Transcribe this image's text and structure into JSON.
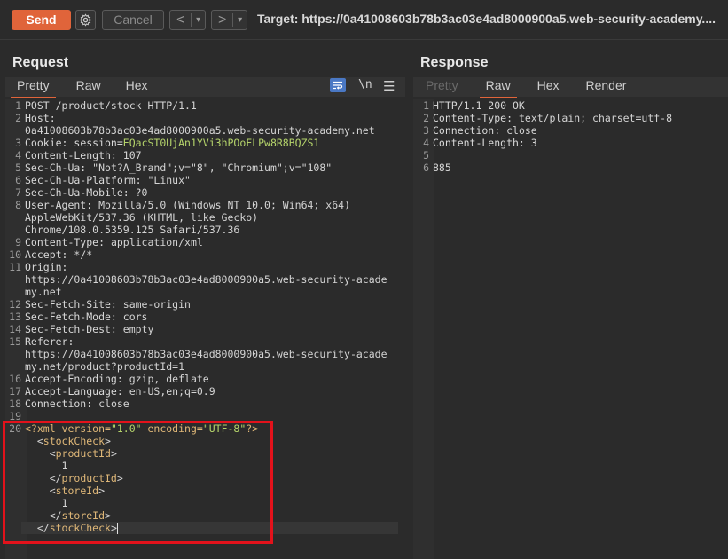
{
  "toolbar": {
    "send_label": "Send",
    "cancel_label": "Cancel",
    "back_arrow": "<",
    "forward_arrow": ">",
    "dropdown_arrow": "▾",
    "target_text": "Target: https://0a41008603b78b3ac03e4ad8000900a5.web-security-academy...."
  },
  "request": {
    "title": "Request",
    "tabs": [
      "Pretty",
      "Raw",
      "Hex"
    ],
    "active_tab": "Pretty",
    "newline_toggle": "\\n",
    "lines": [
      {
        "n": "1",
        "parts": [
          [
            "POST /product/stock HTTP/1.1",
            "txt"
          ]
        ]
      },
      {
        "n": "2",
        "parts": [
          [
            "Host:",
            "k"
          ]
        ]
      },
      {
        "n": "",
        "parts": [
          [
            "0a41008603b78b3ac03e4ad8000900a5.web-security-academy.net",
            "v"
          ]
        ]
      },
      {
        "n": "3",
        "parts": [
          [
            "Cookie: ",
            "k"
          ],
          [
            "session",
            "k"
          ],
          [
            "=",
            "k"
          ],
          [
            "EQacST0UjAn1YVi3hPOoFLPw8R8BQZS1",
            "cookie"
          ]
        ]
      },
      {
        "n": "4",
        "parts": [
          [
            "Content-Length: ",
            "k"
          ],
          [
            "107",
            "v"
          ]
        ]
      },
      {
        "n": "5",
        "parts": [
          [
            "Sec-Ch-Ua: ",
            "k"
          ],
          [
            "\"Not?A_Brand\";v=\"8\", \"Chromium\";v=\"108\"",
            "v"
          ]
        ]
      },
      {
        "n": "6",
        "parts": [
          [
            "Sec-Ch-Ua-Platform: ",
            "k"
          ],
          [
            "\"Linux\"",
            "v"
          ]
        ]
      },
      {
        "n": "7",
        "parts": [
          [
            "Sec-Ch-Ua-Mobile: ",
            "k"
          ],
          [
            "?0",
            "v"
          ]
        ]
      },
      {
        "n": "8",
        "parts": [
          [
            "User-Agent: ",
            "k"
          ],
          [
            "Mozilla/5.0 (Windows NT 10.0; Win64; x64)",
            "v"
          ]
        ]
      },
      {
        "n": "",
        "parts": [
          [
            "AppleWebKit/537.36 (KHTML, like Gecko)",
            "v"
          ]
        ]
      },
      {
        "n": "",
        "parts": [
          [
            "Chrome/108.0.5359.125 Safari/537.36",
            "v"
          ]
        ]
      },
      {
        "n": "9",
        "parts": [
          [
            "Content-Type: ",
            "k"
          ],
          [
            "application/xml",
            "v"
          ]
        ]
      },
      {
        "n": "10",
        "parts": [
          [
            "Accept: ",
            "k"
          ],
          [
            "*/*",
            "v"
          ]
        ]
      },
      {
        "n": "11",
        "parts": [
          [
            "Origin:",
            "k"
          ]
        ]
      },
      {
        "n": "",
        "parts": [
          [
            "https://0a41008603b78b3ac03e4ad8000900a5.web-security-acade",
            "v"
          ]
        ]
      },
      {
        "n": "",
        "parts": [
          [
            "my.net",
            "v"
          ]
        ]
      },
      {
        "n": "12",
        "parts": [
          [
            "Sec-Fetch-Site: ",
            "k"
          ],
          [
            "same-origin",
            "v"
          ]
        ]
      },
      {
        "n": "13",
        "parts": [
          [
            "Sec-Fetch-Mode: ",
            "k"
          ],
          [
            "cors",
            "v"
          ]
        ]
      },
      {
        "n": "14",
        "parts": [
          [
            "Sec-Fetch-Dest: ",
            "k"
          ],
          [
            "empty",
            "v"
          ]
        ]
      },
      {
        "n": "15",
        "parts": [
          [
            "Referer:",
            "k"
          ]
        ]
      },
      {
        "n": "",
        "parts": [
          [
            "https://0a41008603b78b3ac03e4ad8000900a5.web-security-acade",
            "v"
          ]
        ]
      },
      {
        "n": "",
        "parts": [
          [
            "my.net/product?productId=1",
            "v"
          ]
        ]
      },
      {
        "n": "16",
        "parts": [
          [
            "Accept-Encoding: ",
            "k"
          ],
          [
            "gzip, deflate",
            "v"
          ]
        ]
      },
      {
        "n": "17",
        "parts": [
          [
            "Accept-Language: ",
            "k"
          ],
          [
            "en-US,en;q=0.9",
            "v"
          ]
        ]
      },
      {
        "n": "18",
        "parts": [
          [
            "Connection: ",
            "k"
          ],
          [
            "close",
            "v"
          ]
        ]
      },
      {
        "n": "19",
        "parts": []
      },
      {
        "n": "20",
        "parts": [
          [
            "<?xml version=",
            "tag"
          ],
          [
            "\"1.0\"",
            "str"
          ],
          [
            " encoding=",
            "tag"
          ],
          [
            "\"UTF-8\"",
            "str"
          ],
          [
            "?>",
            "tag"
          ]
        ]
      },
      {
        "n": "",
        "parts": [
          [
            "  <",
            "txt"
          ],
          [
            "stockCheck",
            "tag"
          ],
          [
            ">",
            "txt"
          ]
        ]
      },
      {
        "n": "",
        "parts": [
          [
            "    <",
            "txt"
          ],
          [
            "productId",
            "tag"
          ],
          [
            ">",
            "txt"
          ]
        ]
      },
      {
        "n": "",
        "parts": [
          [
            "      1",
            "txt"
          ]
        ]
      },
      {
        "n": "",
        "parts": [
          [
            "    </",
            "txt"
          ],
          [
            "productId",
            "tag"
          ],
          [
            ">",
            "txt"
          ]
        ]
      },
      {
        "n": "",
        "parts": [
          [
            "    <",
            "txt"
          ],
          [
            "storeId",
            "tag"
          ],
          [
            ">",
            "txt"
          ]
        ]
      },
      {
        "n": "",
        "parts": [
          [
            "      1",
            "txt"
          ]
        ]
      },
      {
        "n": "",
        "parts": [
          [
            "    </",
            "txt"
          ],
          [
            "storeId",
            "tag"
          ],
          [
            ">",
            "txt"
          ]
        ]
      },
      {
        "n": "",
        "parts": [
          [
            "  </",
            "txt"
          ],
          [
            "stockCheck",
            "tag"
          ],
          [
            ">",
            "txt"
          ]
        ]
      }
    ]
  },
  "response": {
    "title": "Response",
    "tabs": [
      "Pretty",
      "Raw",
      "Hex",
      "Render"
    ],
    "active_tab": "Raw",
    "disabled_tab": "Pretty",
    "lines": [
      {
        "n": "1",
        "parts": [
          [
            "HTTP/1.1 200 OK",
            "txt"
          ]
        ]
      },
      {
        "n": "2",
        "parts": [
          [
            "Content-Type: ",
            "k"
          ],
          [
            "text/plain; charset=utf-8",
            "v"
          ]
        ]
      },
      {
        "n": "3",
        "parts": [
          [
            "Connection: ",
            "k"
          ],
          [
            "close",
            "v"
          ]
        ]
      },
      {
        "n": "4",
        "parts": [
          [
            "Content-Length: ",
            "k"
          ],
          [
            "3",
            "v"
          ]
        ]
      },
      {
        "n": "5",
        "parts": []
      },
      {
        "n": "6",
        "parts": [
          [
            "885",
            "txt"
          ]
        ]
      }
    ]
  },
  "colors": {
    "send_button": "#e0643a",
    "highlight_box": "#e3121b",
    "tag_color": "#e0b878",
    "string_color": "#b5d46b"
  }
}
